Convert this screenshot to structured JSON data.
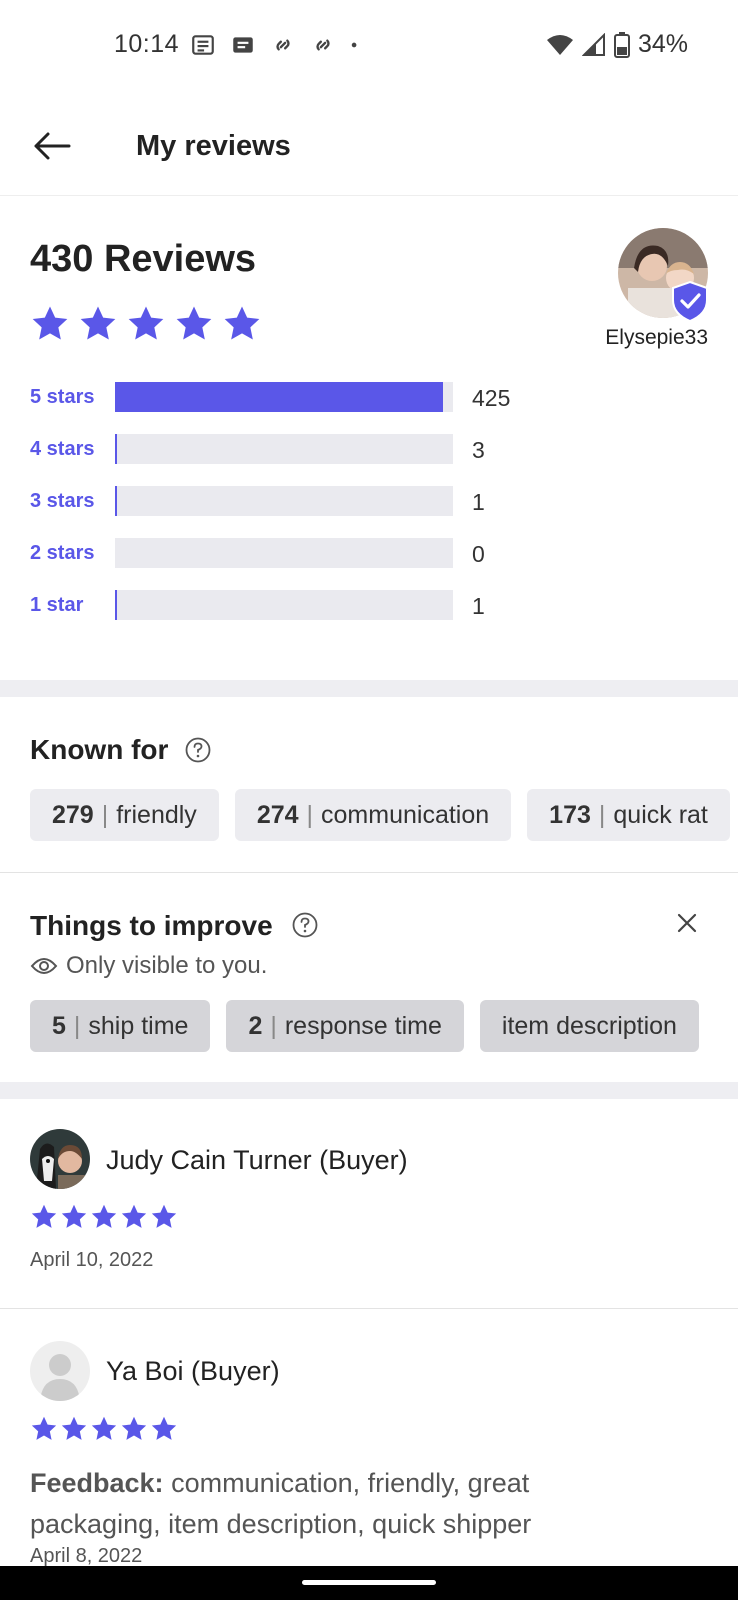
{
  "status_bar": {
    "time": "10:14",
    "battery": "34%",
    "icons_left": [
      "newspaper-icon",
      "message-icon",
      "link-icon",
      "link-icon",
      "dot-icon"
    ],
    "icons_right": [
      "wifi-icon",
      "signal-icon",
      "battery-icon"
    ]
  },
  "header": {
    "back_icon": "arrow-left-icon",
    "title": "My reviews"
  },
  "summary": {
    "total_label": "430 Reviews",
    "average_stars": 5,
    "username": "Elysepie33",
    "accent_color": "#5a57e8",
    "distribution": [
      {
        "label": "5 stars",
        "count": "425",
        "fraction": 1.0
      },
      {
        "label": "4 stars",
        "count": "3",
        "fraction": 0.007
      },
      {
        "label": "3 stars",
        "count": "1",
        "fraction": 0.002
      },
      {
        "label": "2 stars",
        "count": "0",
        "fraction": 0.0
      },
      {
        "label": "1 star",
        "count": "1",
        "fraction": 0.002
      }
    ]
  },
  "known_for": {
    "title": "Known for",
    "chips": [
      {
        "count": "279",
        "label": "friendly"
      },
      {
        "count": "274",
        "label": "communication"
      },
      {
        "count": "173",
        "label": "quick rat"
      }
    ]
  },
  "improve": {
    "title": "Things to improve",
    "note": "Only visible to you.",
    "chips": [
      {
        "count": "5",
        "label": "ship time"
      },
      {
        "count": "2",
        "label": "response time"
      },
      {
        "count": "",
        "label": "item description"
      }
    ]
  },
  "reviews": [
    {
      "name": "Judy Cain Turner (Buyer)",
      "stars": 5,
      "date": "April 10, 2022"
    },
    {
      "name": "Ya Boi (Buyer)",
      "stars": 5,
      "feedback_label": "Feedback:",
      "feedback_text": " communication, friendly, great packaging, item description, quick shipper",
      "date": "April 8, 2022"
    }
  ]
}
